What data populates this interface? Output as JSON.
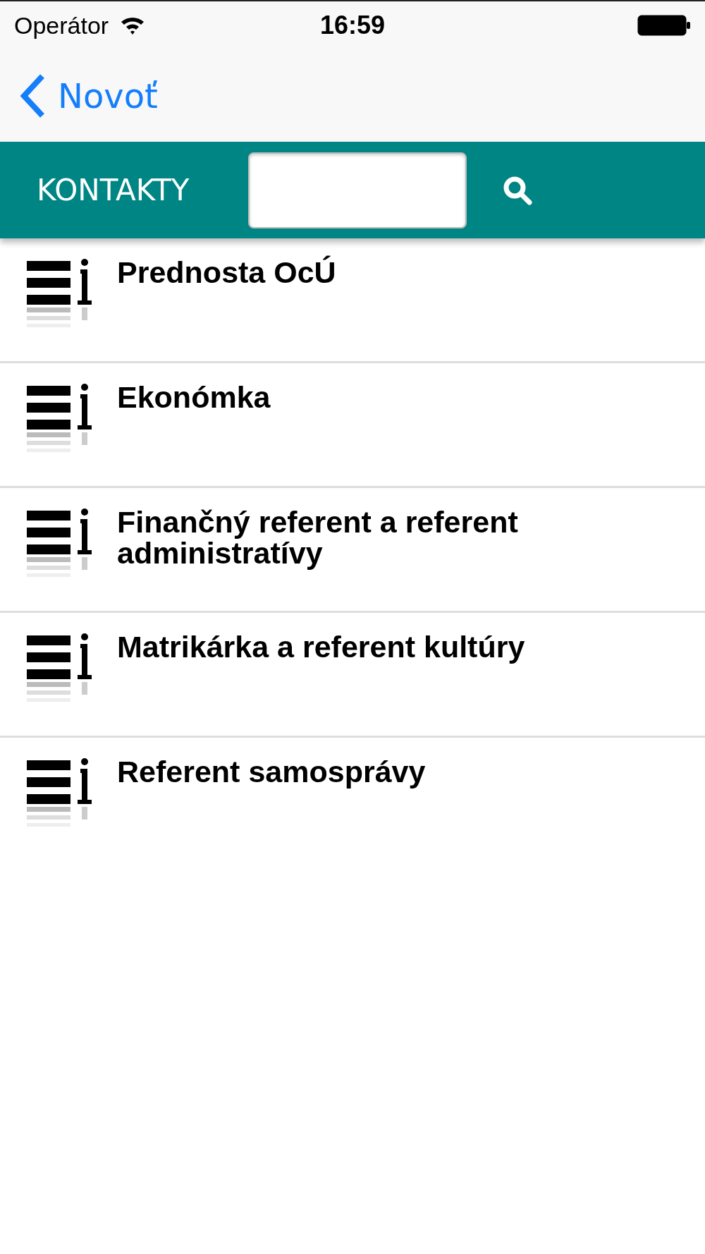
{
  "status_bar": {
    "carrier": "Operátor",
    "time": "16:59"
  },
  "nav_bar": {
    "back_label": "Novoť"
  },
  "header": {
    "title": "KONTAKTY"
  },
  "contacts": [
    {
      "name": "Prednosta OcÚ"
    },
    {
      "name": "Ekonómka"
    },
    {
      "name": "Finančný referent a referent administratívy"
    },
    {
      "name": "Matrikárka a referent kultúry"
    },
    {
      "name": "Referent samosprávy"
    }
  ]
}
